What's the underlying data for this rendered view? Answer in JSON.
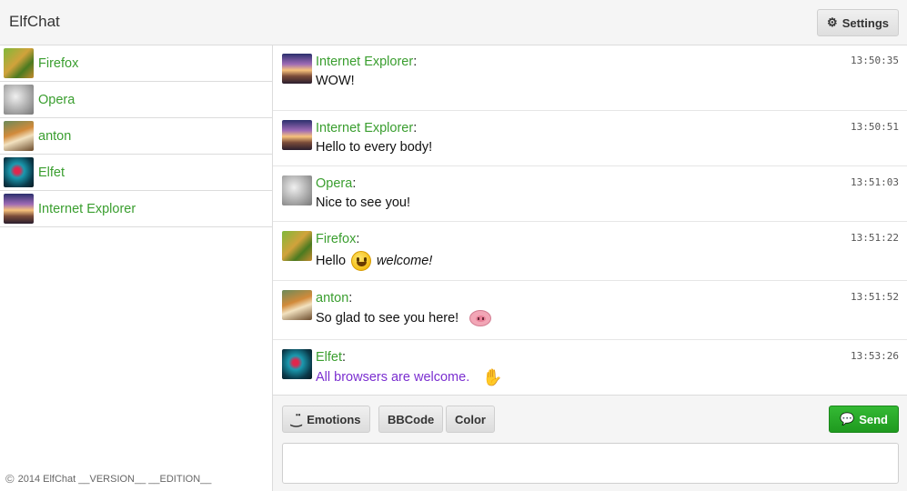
{
  "app": {
    "title": "ElfChat"
  },
  "header": {
    "settings_label": "Settings",
    "settings_icon": "gear-icon"
  },
  "sidebar": {
    "users": [
      {
        "name": "Firefox",
        "avatar": "firefox"
      },
      {
        "name": "Opera",
        "avatar": "opera"
      },
      {
        "name": "anton",
        "avatar": "anton"
      },
      {
        "name": "Elfet",
        "avatar": "elfet"
      },
      {
        "name": "Internet Explorer",
        "avatar": "ie"
      }
    ],
    "footer": "2014 ElfChat __VERSION__ __EDITION__"
  },
  "messages": [
    {
      "author": "Internet Explorer",
      "time": "13:50:35",
      "text": "WOW!"
    },
    {
      "author": "Internet Explorer",
      "time": "13:50:51",
      "text": "Hello to every body!"
    },
    {
      "author": "Opera",
      "time": "13:51:03",
      "text": "Nice to see you!"
    },
    {
      "author": "Firefox",
      "time": "13:51:22",
      "text": "Hello",
      "emoji": "smiley",
      "text_after": "welcome!"
    },
    {
      "author": "anton",
      "time": "13:51:52",
      "text": "So glad to see you here!",
      "emoji": "pig"
    },
    {
      "author": "Elfet",
      "time": "13:53:26",
      "text": "All browsers are welcome.",
      "emoji": "raised-hand",
      "text_color": "#7b2fd0"
    }
  ],
  "toolbar": {
    "emotions_label": "Emotions",
    "bbcode_label": "BBCode",
    "color_label": "Color",
    "send_label": "Send"
  },
  "colors": {
    "author": "#3a9e2f",
    "send": "#22a322",
    "header_bg": "#f5f5f5"
  }
}
